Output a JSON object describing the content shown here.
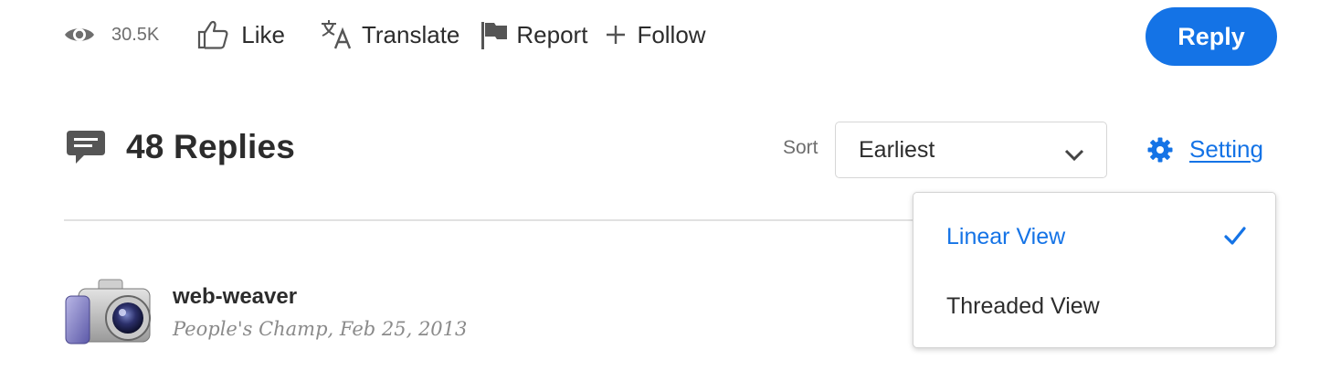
{
  "actions": {
    "views_count": "30.5K",
    "like_label": "Like",
    "translate_label": "Translate",
    "report_label": "Report",
    "follow_label": "Follow",
    "reply_label": "Reply"
  },
  "replies": {
    "title": "48 Replies",
    "sort_label": "Sort",
    "sort_value": "Earliest",
    "setting_label": "Setting"
  },
  "view_menu": {
    "items": [
      {
        "label": "Linear View",
        "selected": true
      },
      {
        "label": "Threaded View",
        "selected": false
      }
    ]
  },
  "post": {
    "author": "web-weaver",
    "rank": "People's Champ",
    "date": "Feb 25, 2013"
  },
  "icons": {
    "views": "eye-icon",
    "like": "thumbs-up-icon",
    "translate": "translate-icon",
    "report": "flag-icon",
    "follow": "plus-icon",
    "replies": "comment-icon",
    "sort": "chevron-down-icon",
    "setting": "gear-icon",
    "selected": "check-icon",
    "avatar": "camera-avatar-icon"
  },
  "colors": {
    "accent": "#1473e6",
    "text": "#2c2c2c",
    "muted": "#6e6e6e",
    "divider": "#e1e1e1"
  }
}
